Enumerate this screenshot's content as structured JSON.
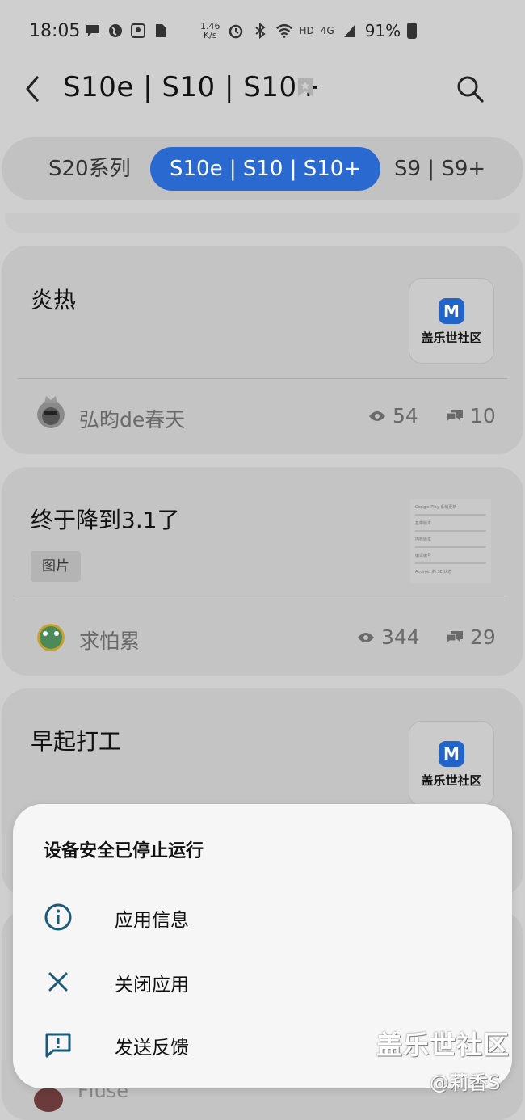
{
  "status_bar": {
    "time": "18:05",
    "net_speed_value": "1.46",
    "net_speed_unit": "K/s",
    "hd": "HD",
    "network": "4G",
    "battery": "91%"
  },
  "header": {
    "title": "S10e | S10 | S10+"
  },
  "tabs": [
    {
      "label": "S20系列",
      "active": false
    },
    {
      "label": "S10e | S10 | S10+",
      "active": true
    },
    {
      "label": "S9 | S9+",
      "active": false
    }
  ],
  "posts": [
    {
      "title": "炎热",
      "thumbnail_logo_text": "盖乐世社区",
      "author": "弘昀de春天",
      "views": "54",
      "comments": "10"
    },
    {
      "title": "终于降到3.1了",
      "tag": "图片",
      "thumbnail_lines": [
        "Google Play 系统更新",
        "基带版本",
        "内核版本",
        "编译编号",
        "Android 的 SE 状态"
      ],
      "author": "求怕累",
      "views": "344",
      "comments": "29"
    },
    {
      "title": "早起打工",
      "thumbnail_logo_text": "盖乐世社区"
    }
  ],
  "dialog": {
    "title": "设备安全已停止运行",
    "items": [
      {
        "label": "应用信息",
        "icon": "info-icon"
      },
      {
        "label": "关闭应用",
        "icon": "close-icon"
      },
      {
        "label": "发送反馈",
        "icon": "feedback-icon"
      }
    ]
  },
  "bottom_peek": {
    "author_partial": "Fluse"
  },
  "watermark": {
    "line1": "盖乐世社区",
    "line2": "@莉香S"
  },
  "colors": {
    "accent": "#2a6ad0",
    "dialog_icon": "#1a5a78"
  }
}
